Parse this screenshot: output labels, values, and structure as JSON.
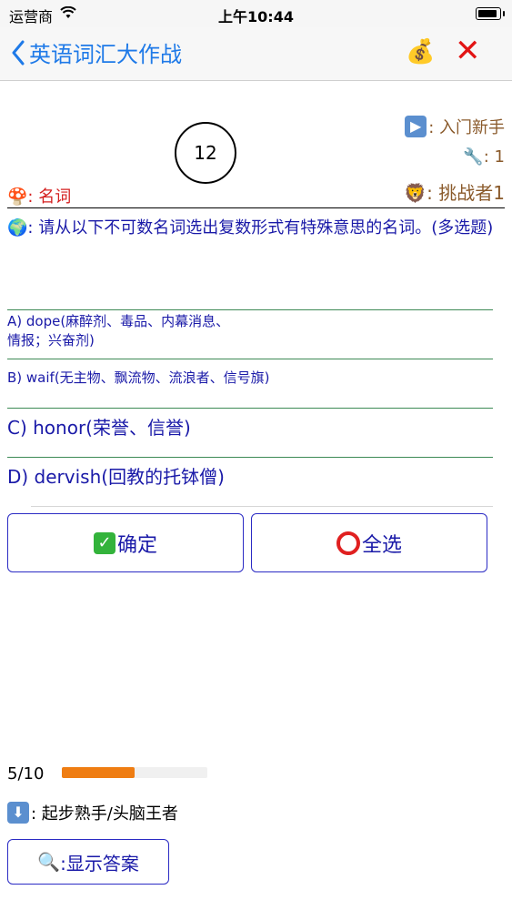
{
  "status_bar": {
    "carrier": "运营商",
    "time": "上午10:44"
  },
  "nav": {
    "back_label": "英语词汇大作战"
  },
  "info": {
    "mode_label": ": 入门新手",
    "tool_label": ": 1",
    "challenger_label": ": 挑战者1",
    "timer": "12",
    "part_of_speech": ": 名词"
  },
  "question": ": 请从以下不可数名词选出复数形式有特殊意思的名词。(多选题)",
  "options": [
    {
      "label": "A) dope(麻醉剂、毒品、内幕消息、\n情报；兴奋剂)"
    },
    {
      "label": "B) waif(无主物、飘流物、流浪者、信号旗)"
    },
    {
      "label": "C) honor(荣誉、信誉)"
    },
    {
      "label": "D) dervish(回教的托钵僧)"
    }
  ],
  "buttons": {
    "confirm": "确定",
    "select_all": "全选",
    "show_answer": ":显示答案"
  },
  "progress": {
    "text": "5/10",
    "value": 0.5,
    "color": "#ef7d12"
  },
  "level": ": 起步熟手/头脑王者"
}
